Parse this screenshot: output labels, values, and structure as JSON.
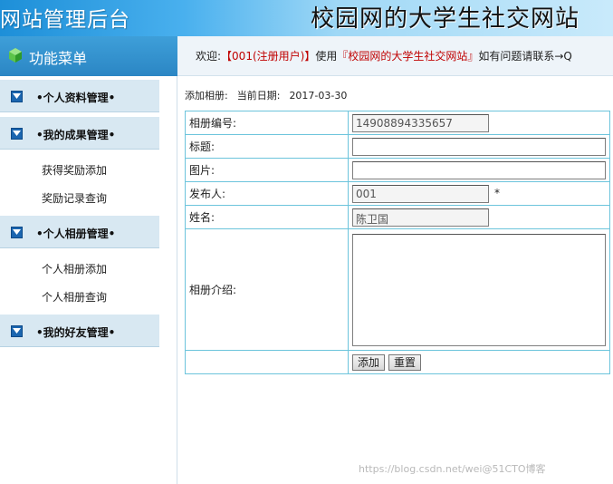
{
  "header": {
    "left_title": "网站管理后台",
    "right_title": "校园网的大学生社交网站"
  },
  "menu": {
    "title": "功能菜单"
  },
  "welcome": {
    "prefix": "欢迎:",
    "user": "【001(注册用户)】",
    "middle": "使用",
    "site": "『校园网的大学生社交网站』",
    "suffix": "如有问题请联系→Q"
  },
  "sidebar": {
    "categories": [
      {
        "label": "•个人资料管理•"
      },
      {
        "label": "•我的成果管理•",
        "items": [
          "获得奖励添加",
          "奖励记录查询"
        ]
      },
      {
        "label": "•个人相册管理•",
        "items": [
          "个人相册添加",
          "个人相册查询"
        ]
      },
      {
        "label": "•我的好友管理•"
      }
    ]
  },
  "main": {
    "section": "添加相册:",
    "date_label": "当前日期:",
    "date_value": "2017-03-30"
  },
  "form": {
    "album_no": {
      "label": "相册编号:",
      "value": "14908894335657"
    },
    "title": {
      "label": "标题:",
      "value": ""
    },
    "image": {
      "label": "图片:",
      "value": ""
    },
    "publisher": {
      "label": "发布人:",
      "value": "001",
      "required": "*"
    },
    "name": {
      "label": "姓名:",
      "value": "陈卫国"
    },
    "intro": {
      "label": "相册介绍:",
      "value": ""
    },
    "buttons": {
      "add": "添加",
      "reset": "重置"
    }
  },
  "watermark": "https://blog.csdn.net/wei@51CTO博客",
  "colors": {
    "header_blue": "#1d8fd8",
    "menu_blue": "#2b86c4",
    "table_border": "#6cc4dc",
    "user_red": "#c00000"
  }
}
